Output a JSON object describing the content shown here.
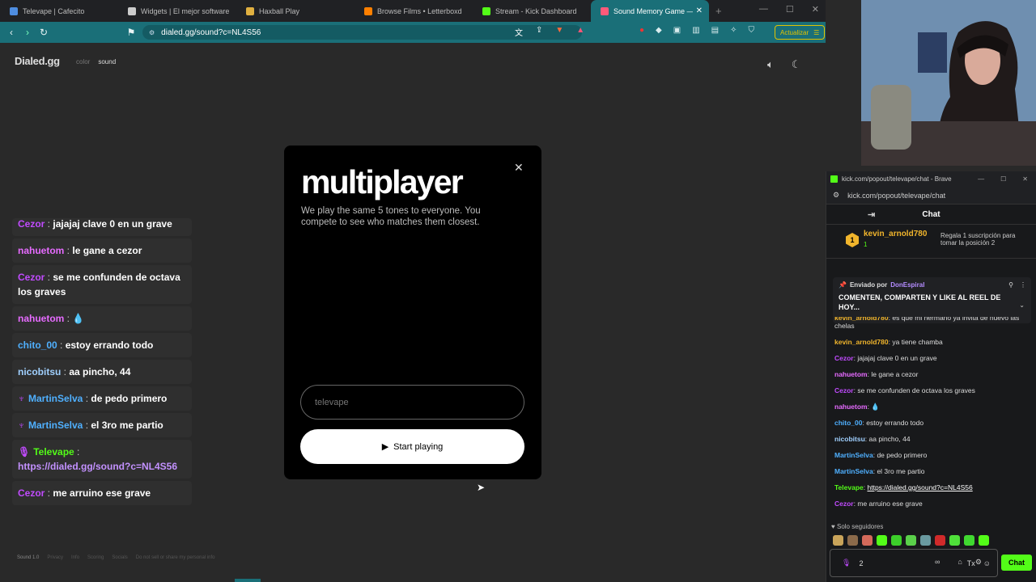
{
  "tabs": [
    {
      "label": "Televape | Cafecito",
      "color": "#4e8de0"
    },
    {
      "label": "Widgets | El mejor software para",
      "color": "#cccccc"
    },
    {
      "label": "Haxball Play",
      "color": "#e0b040"
    },
    {
      "label": "Browse Films • Letterboxd",
      "color": "#ff8000"
    },
    {
      "label": "Stream - Kick Dashboard",
      "color": "#53fc18"
    },
    {
      "label": "Sound Memory Game — H",
      "color": "#ff5a7a",
      "active": true
    }
  ],
  "url": "dialed.gg/sound?c=NL4S56",
  "update_label": "Actualizar",
  "site": {
    "brand": "Dialed.gg",
    "nav_color": "color",
    "nav_sound": "sound"
  },
  "chat_overlay": [
    {
      "user": "Cezor",
      "text": "jajajaj clave 0 en un grave",
      "color": "#c14bff"
    },
    {
      "user": "nahuetom",
      "text": "le gane a cezor",
      "color": "#e66bff"
    },
    {
      "user": "Cezor",
      "text": "se me confunden de octava los graves",
      "color": "#c14bff"
    },
    {
      "user": "nahuetom",
      "text": "💧",
      "color": "#e66bff"
    },
    {
      "user": "chito_00",
      "text": "estoy errando todo",
      "color": "#4fb0ff"
    },
    {
      "user": "nicobitsu",
      "text": "aa pincho, 44",
      "color": "#a0d0ff"
    },
    {
      "user": "MartinSelva",
      "text": "de pedo primero",
      "color": "#4fb0ff",
      "badge": "♆"
    },
    {
      "user": "MartinSelva",
      "text": "el 3ro me partio",
      "color": "#4fb0ff",
      "badge": "♆"
    },
    {
      "user": "Televape",
      "text": "https://dialed.gg/sound?c=NL4S56",
      "color": "#53fc18",
      "badge": "🎙",
      "link": true
    },
    {
      "user": "Cezor",
      "text": "me arruino ese grave",
      "color": "#c14bff"
    }
  ],
  "modal": {
    "title": "multiplayer",
    "description": "We play the same 5 tones to everyone. You compete to see who matches them closest.",
    "placeholder": "televape",
    "start_label": "Start playing"
  },
  "footer": [
    "Sound 1.0",
    "Privacy",
    "Info",
    "Scoring",
    "Socials",
    "Do not sell or share my personal info"
  ],
  "chat_window": {
    "title": "kick.com/popout/televape/chat - Brave",
    "url": "kick.com/popout/televape/chat",
    "header": "Chat",
    "top_user": "kevin_arnold780",
    "top_rank": "1",
    "top_count": "1",
    "gift_text": "Regala 1 suscripción para tomar la posición 2",
    "pinned_by_label": "Enviado por",
    "pinned_user": "DonEspiral",
    "pinned_text": "COMENTEN, COMPARTEN Y LIKE AL REEL DE HOY...",
    "messages": [
      {
        "user": "kevin_arnold780",
        "text": "es que mi hermano ya invita de nuevo las chelas",
        "color": "#f1b52c"
      },
      {
        "user": "kevin_arnold780",
        "text": "ya tiene chamba",
        "color": "#f1b52c"
      },
      {
        "user": "Cezor",
        "text": "jajajaj clave 0 en un grave",
        "color": "#c14bff"
      },
      {
        "user": "nahuetom",
        "text": "le gane a cezor",
        "color": "#e66bff"
      },
      {
        "user": "Cezor",
        "text": "se me confunden de octava los graves",
        "color": "#c14bff"
      },
      {
        "user": "nahuetom",
        "text": "💧",
        "color": "#e66bff"
      },
      {
        "user": "chito_00",
        "text": "estoy errando todo",
        "color": "#4fb0ff"
      },
      {
        "user": "nicobitsu",
        "text": "aa pincho, 44",
        "color": "#a0d0ff"
      },
      {
        "user": "MartinSelva",
        "text": "de pedo primero",
        "color": "#4fb0ff"
      },
      {
        "user": "MartinSelva",
        "text": "el 3ro me partio",
        "color": "#4fb0ff"
      },
      {
        "user": "Televape",
        "text": "https://dialed.gg/sound?c=NL4S56",
        "color": "#53fc18",
        "link": true
      },
      {
        "user": "Cezor",
        "text": "me arruino ese grave",
        "color": "#c14bff"
      }
    ],
    "followers_only": "Solo seguidores",
    "input_count": "2",
    "send_label": "Chat"
  }
}
